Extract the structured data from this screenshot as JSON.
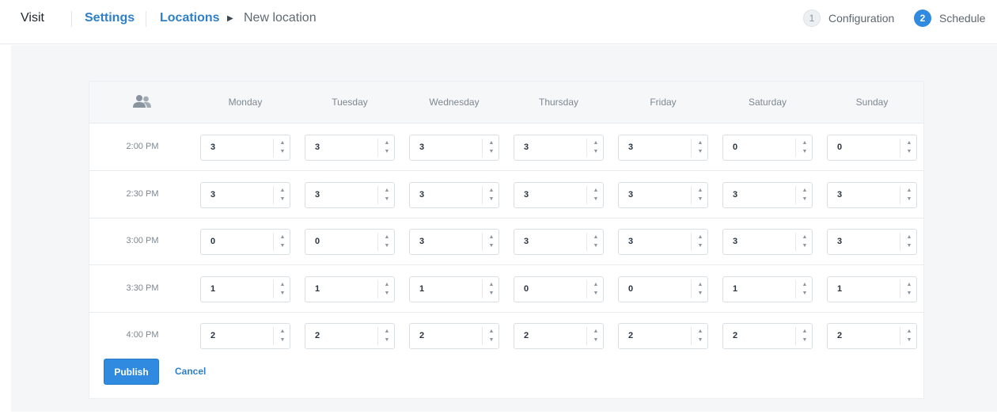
{
  "nav": {
    "brand": "Visit",
    "breadcrumb": {
      "settings": "Settings",
      "locations": "Locations",
      "current": "New location"
    },
    "steps": [
      {
        "number": "1",
        "label": "Configuration",
        "active": false
      },
      {
        "number": "2",
        "label": "Schedule",
        "active": true
      }
    ]
  },
  "schedule": {
    "header_icon": "people-icon",
    "days": [
      "Monday",
      "Tuesday",
      "Wednesday",
      "Thursday",
      "Friday",
      "Saturday",
      "Sunday"
    ],
    "rows": [
      {
        "time": "2:00 PM",
        "values": [
          "3",
          "3",
          "3",
          "3",
          "3",
          "0",
          "0"
        ]
      },
      {
        "time": "2:30 PM",
        "values": [
          "3",
          "3",
          "3",
          "3",
          "3",
          "3",
          "3"
        ]
      },
      {
        "time": "3:00 PM",
        "values": [
          "0",
          "0",
          "3",
          "3",
          "3",
          "3",
          "3"
        ]
      },
      {
        "time": "3:30 PM",
        "values": [
          "1",
          "1",
          "1",
          "0",
          "0",
          "1",
          "1"
        ]
      },
      {
        "time": "4:00 PM",
        "values": [
          "2",
          "2",
          "2",
          "2",
          "2",
          "2",
          "2"
        ]
      }
    ]
  },
  "actions": {
    "publish": "Publish",
    "cancel": "Cancel"
  },
  "colors": {
    "accent": "#2f8ae0",
    "link": "#2f7fc8",
    "background": "#f5f6f8"
  }
}
